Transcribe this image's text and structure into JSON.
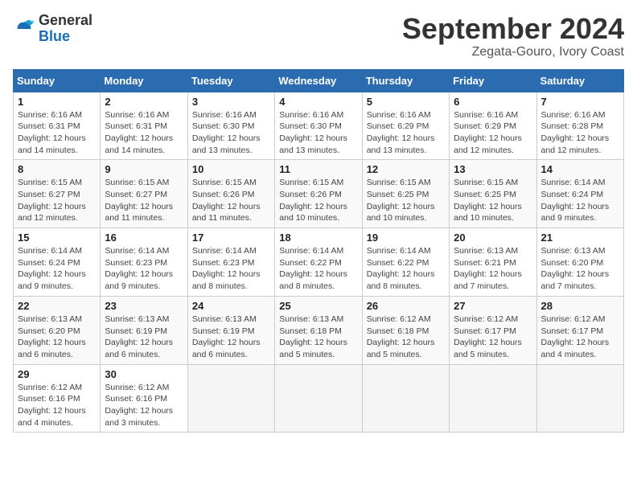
{
  "logo": {
    "general": "General",
    "blue": "Blue"
  },
  "title": {
    "month_year": "September 2024",
    "location": "Zegata-Gouro, Ivory Coast"
  },
  "weekdays": [
    "Sunday",
    "Monday",
    "Tuesday",
    "Wednesday",
    "Thursday",
    "Friday",
    "Saturday"
  ],
  "weeks": [
    [
      {
        "day": "1",
        "sunrise": "6:16 AM",
        "sunset": "6:31 PM",
        "daylight": "12 hours and 14 minutes."
      },
      {
        "day": "2",
        "sunrise": "6:16 AM",
        "sunset": "6:31 PM",
        "daylight": "12 hours and 14 minutes."
      },
      {
        "day": "3",
        "sunrise": "6:16 AM",
        "sunset": "6:30 PM",
        "daylight": "12 hours and 13 minutes."
      },
      {
        "day": "4",
        "sunrise": "6:16 AM",
        "sunset": "6:30 PM",
        "daylight": "12 hours and 13 minutes."
      },
      {
        "day": "5",
        "sunrise": "6:16 AM",
        "sunset": "6:29 PM",
        "daylight": "12 hours and 13 minutes."
      },
      {
        "day": "6",
        "sunrise": "6:16 AM",
        "sunset": "6:29 PM",
        "daylight": "12 hours and 12 minutes."
      },
      {
        "day": "7",
        "sunrise": "6:16 AM",
        "sunset": "6:28 PM",
        "daylight": "12 hours and 12 minutes."
      }
    ],
    [
      {
        "day": "8",
        "sunrise": "6:15 AM",
        "sunset": "6:27 PM",
        "daylight": "12 hours and 12 minutes."
      },
      {
        "day": "9",
        "sunrise": "6:15 AM",
        "sunset": "6:27 PM",
        "daylight": "12 hours and 11 minutes."
      },
      {
        "day": "10",
        "sunrise": "6:15 AM",
        "sunset": "6:26 PM",
        "daylight": "12 hours and 11 minutes."
      },
      {
        "day": "11",
        "sunrise": "6:15 AM",
        "sunset": "6:26 PM",
        "daylight": "12 hours and 10 minutes."
      },
      {
        "day": "12",
        "sunrise": "6:15 AM",
        "sunset": "6:25 PM",
        "daylight": "12 hours and 10 minutes."
      },
      {
        "day": "13",
        "sunrise": "6:15 AM",
        "sunset": "6:25 PM",
        "daylight": "12 hours and 10 minutes."
      },
      {
        "day": "14",
        "sunrise": "6:14 AM",
        "sunset": "6:24 PM",
        "daylight": "12 hours and 9 minutes."
      }
    ],
    [
      {
        "day": "15",
        "sunrise": "6:14 AM",
        "sunset": "6:24 PM",
        "daylight": "12 hours and 9 minutes."
      },
      {
        "day": "16",
        "sunrise": "6:14 AM",
        "sunset": "6:23 PM",
        "daylight": "12 hours and 9 minutes."
      },
      {
        "day": "17",
        "sunrise": "6:14 AM",
        "sunset": "6:23 PM",
        "daylight": "12 hours and 8 minutes."
      },
      {
        "day": "18",
        "sunrise": "6:14 AM",
        "sunset": "6:22 PM",
        "daylight": "12 hours and 8 minutes."
      },
      {
        "day": "19",
        "sunrise": "6:14 AM",
        "sunset": "6:22 PM",
        "daylight": "12 hours and 8 minutes."
      },
      {
        "day": "20",
        "sunrise": "6:13 AM",
        "sunset": "6:21 PM",
        "daylight": "12 hours and 7 minutes."
      },
      {
        "day": "21",
        "sunrise": "6:13 AM",
        "sunset": "6:20 PM",
        "daylight": "12 hours and 7 minutes."
      }
    ],
    [
      {
        "day": "22",
        "sunrise": "6:13 AM",
        "sunset": "6:20 PM",
        "daylight": "12 hours and 6 minutes."
      },
      {
        "day": "23",
        "sunrise": "6:13 AM",
        "sunset": "6:19 PM",
        "daylight": "12 hours and 6 minutes."
      },
      {
        "day": "24",
        "sunrise": "6:13 AM",
        "sunset": "6:19 PM",
        "daylight": "12 hours and 6 minutes."
      },
      {
        "day": "25",
        "sunrise": "6:13 AM",
        "sunset": "6:18 PM",
        "daylight": "12 hours and 5 minutes."
      },
      {
        "day": "26",
        "sunrise": "6:12 AM",
        "sunset": "6:18 PM",
        "daylight": "12 hours and 5 minutes."
      },
      {
        "day": "27",
        "sunrise": "6:12 AM",
        "sunset": "6:17 PM",
        "daylight": "12 hours and 5 minutes."
      },
      {
        "day": "28",
        "sunrise": "6:12 AM",
        "sunset": "6:17 PM",
        "daylight": "12 hours and 4 minutes."
      }
    ],
    [
      {
        "day": "29",
        "sunrise": "6:12 AM",
        "sunset": "6:16 PM",
        "daylight": "12 hours and 4 minutes."
      },
      {
        "day": "30",
        "sunrise": "6:12 AM",
        "sunset": "6:16 PM",
        "daylight": "12 hours and 3 minutes."
      },
      null,
      null,
      null,
      null,
      null
    ]
  ],
  "labels": {
    "sunrise": "Sunrise: ",
    "sunset": "Sunset: ",
    "daylight": "Daylight: "
  }
}
